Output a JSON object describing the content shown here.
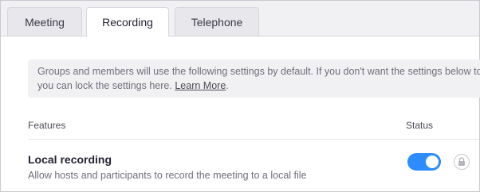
{
  "tabs": [
    {
      "label": "Meeting",
      "active": false
    },
    {
      "label": "Recording",
      "active": true
    },
    {
      "label": "Telephone",
      "active": false
    }
  ],
  "info": {
    "text": "Groups and members will use the following settings by default. If you don't want the settings below to",
    "text2": "you can lock the settings here.",
    "learn_more": "Learn More",
    "period": "."
  },
  "columns": {
    "features": "Features",
    "status": "Status"
  },
  "setting": {
    "title": "Local recording",
    "description": "Allow hosts and participants to record the meeting to a local file",
    "enabled": true,
    "lock_icon": "lock-icon"
  },
  "colors": {
    "accent": "#2d8cff",
    "tab_bg": "#e7e7ec",
    "info_bg": "#f1f1f4"
  }
}
